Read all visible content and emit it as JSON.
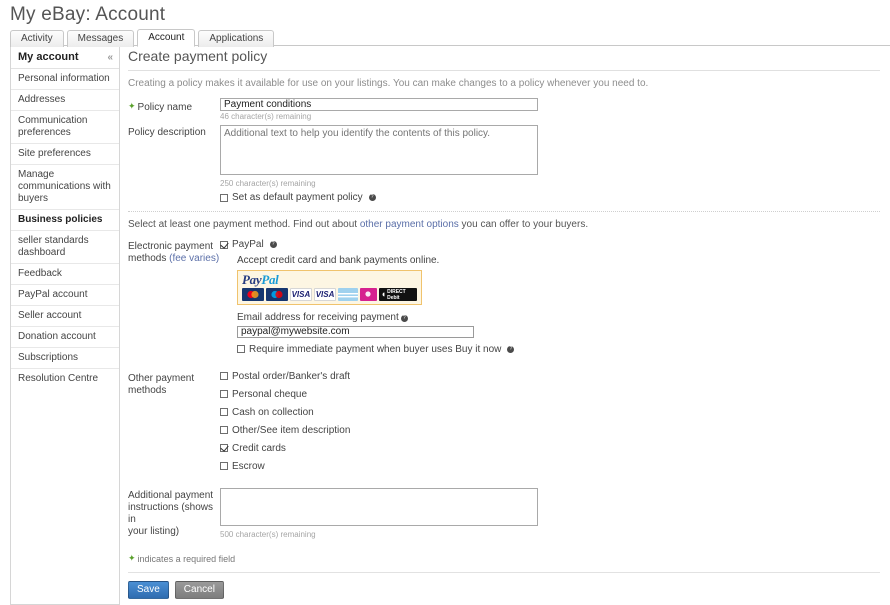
{
  "page": {
    "title": "My eBay: Account"
  },
  "tabs": [
    {
      "label": "Activity",
      "active": false
    },
    {
      "label": "Messages",
      "active": false
    },
    {
      "label": "Account",
      "active": true
    },
    {
      "label": "Applications",
      "active": false
    }
  ],
  "sidebar": {
    "header": "My account",
    "collapse_icon": "«",
    "items": [
      {
        "label": "Personal information",
        "bold": false
      },
      {
        "label": "Addresses",
        "bold": false
      },
      {
        "label": "Communication preferences",
        "bold": false
      },
      {
        "label": "Site preferences",
        "bold": false
      },
      {
        "label": "Manage communications with buyers",
        "bold": false
      },
      {
        "label": "Business policies",
        "bold": true
      },
      {
        "label": "seller standards dashboard",
        "bold": false
      },
      {
        "label": "Feedback",
        "bold": false
      },
      {
        "label": "PayPal account",
        "bold": false
      },
      {
        "label": "Seller account",
        "bold": false
      },
      {
        "label": "Donation account",
        "bold": false
      },
      {
        "label": "Subscriptions",
        "bold": false
      },
      {
        "label": "Resolution Centre",
        "bold": false
      }
    ]
  },
  "main": {
    "title": "Create payment policy",
    "intro": "Creating a policy makes it available for use on your listings. You can make changes to a policy whenever you need to.",
    "policy_name": {
      "label": "Policy name",
      "value": "Payment conditions",
      "counter": "46 character(s) remaining"
    },
    "policy_description": {
      "label": "Policy description",
      "value": "",
      "placeholder": "Additional text to help you identify the contents of this policy.",
      "counter": "250 character(s) remaining"
    },
    "default_policy": {
      "label": "Set as default payment policy",
      "checked": false
    },
    "select_note_pre": "Select at least one payment method. Find out about ",
    "select_note_link": "other payment options",
    "select_note_post": " you can offer to your buyers.",
    "electronic": {
      "label_line1": "Electronic payment",
      "label_line2_pre": "methods ",
      "label_line2_link": "(fee varies)",
      "paypal_label": "PayPal",
      "paypal_checked": true,
      "accept_text": "Accept credit card and bank payments online.",
      "banner": {
        "brand_a": "Pay",
        "brand_b": "Pal",
        "cards": [
          {
            "name": "mastercard-logo",
            "text": "MasterCard"
          },
          {
            "name": "maestro-logo",
            "text": "Maestro"
          },
          {
            "name": "visa-logo",
            "text": "VISA"
          },
          {
            "name": "visa-electron-logo",
            "text": "VISA"
          },
          {
            "name": "amex-logo",
            "text": "AMEX"
          },
          {
            "name": "discover-logo",
            "text": "D"
          },
          {
            "name": "direct-debit-logo",
            "text": "DIRECT Debit"
          }
        ]
      },
      "email_label": "Email address for receiving payment",
      "email_value": "paypal@mywebsite.com",
      "immediate_label": "Require immediate payment when buyer uses Buy it now",
      "immediate_checked": false
    },
    "other_methods": {
      "label": "Other payment methods",
      "items": [
        {
          "label": "Postal order/Banker's draft",
          "checked": false
        },
        {
          "label": "Personal cheque",
          "checked": false
        },
        {
          "label": "Cash on collection",
          "checked": false
        },
        {
          "label": "Other/See item description",
          "checked": false
        },
        {
          "label": "Credit cards",
          "checked": true
        },
        {
          "label": "Escrow",
          "checked": false
        }
      ]
    },
    "additional": {
      "label_line1": "Additional payment",
      "label_line2": "instructions (shows in",
      "label_line3": "your listing)",
      "value": "",
      "counter": "500 character(s) remaining"
    },
    "required_note": "indicates a required field",
    "save_label": "Save",
    "cancel_label": "Cancel"
  },
  "colors": {
    "link": "#5b6fa8",
    "required_star": "#5aa02c",
    "save_button": "#2f6cb0",
    "cancel_button": "#7d7d7d"
  }
}
